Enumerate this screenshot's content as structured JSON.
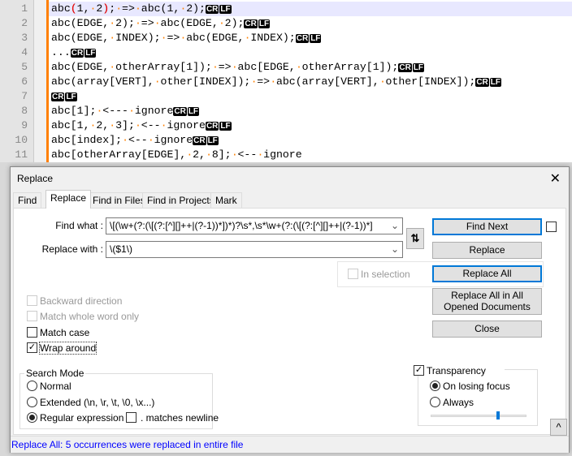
{
  "editor": {
    "lines": [
      {
        "num": "1",
        "text": "abc(1, 2); => abc(1, 2);",
        "eol": true
      },
      {
        "num": "2",
        "text": "abc(EDGE, 2); => abc(EDGE, 2);",
        "eol": true
      },
      {
        "num": "3",
        "text": "abc(EDGE, INDEX); => abc(EDGE, INDEX);",
        "eol": true
      },
      {
        "num": "4",
        "text": "...",
        "eol": true
      },
      {
        "num": "5",
        "text": "abc(EDGE, otherArray[1]); => abc[EDGE, otherArray[1]);",
        "eol": true
      },
      {
        "num": "6",
        "text": "abc(array[VERT], other[INDEX]); => abc(array[VERT], other[INDEX]);",
        "eol": true
      },
      {
        "num": "7",
        "text": "",
        "eol": true
      },
      {
        "num": "8",
        "text": "abc[1]; <--- ignore",
        "eol": true
      },
      {
        "num": "9",
        "text": "abc[1, 2, 3]; <-- ignore",
        "eol": true
      },
      {
        "num": "10",
        "text": "abc[index]; <-- ignore",
        "eol": true
      },
      {
        "num": "11",
        "text": "abc[otherArray[EDGE], 2, 8]; <-- ignore",
        "eol": false
      }
    ],
    "eol_cr": "CR",
    "eol_lf": "LF",
    "colors": {
      "whitespace": "#ff8000",
      "change_bar": "#ff8000",
      "brace_match": "#ff0000"
    }
  },
  "dialog": {
    "title": "Replace",
    "close_icon": "close-icon",
    "tabs": [
      "Find",
      "Replace",
      "Find in Files",
      "Find in Projects",
      "Mark"
    ],
    "active_tab": "Replace",
    "find_label": "Find what :",
    "find_value": "\\[(\\w+(?:(\\[(?:[^][]++|(?-1))*])*)?\\s*,\\s*\\w+(?:(\\[(?:[^][]++|(?-1))*]",
    "replace_label": "Replace with :",
    "replace_value": "\\($1\\)",
    "swap_icon": "swap-arrows-icon",
    "buttons": {
      "find_next": "Find Next",
      "replace": "Replace",
      "replace_all": "Replace All",
      "replace_all_opened": "Replace All in All Opened Documents",
      "close": "Close"
    },
    "in_selection": "In selection",
    "options": {
      "backward": "Backward direction",
      "whole_word": "Match whole word only",
      "match_case": "Match case",
      "wrap_around": "Wrap around"
    },
    "search_mode": {
      "title": "Search Mode",
      "normal": "Normal",
      "extended": "Extended (\\n, \\r, \\t, \\0, \\x...)",
      "regex": "Regular expression",
      "dot_newline": ". matches newline",
      "selected": "Regular expression"
    },
    "transparency": {
      "title": "Transparency",
      "on_losing_focus": "On losing focus",
      "always": "Always",
      "checked": true,
      "level_percent": 70
    },
    "collapse_icon": "caret-up-icon",
    "status": "Replace All: 5 occurrences were replaced in entire file",
    "accent": "#0078d7"
  }
}
